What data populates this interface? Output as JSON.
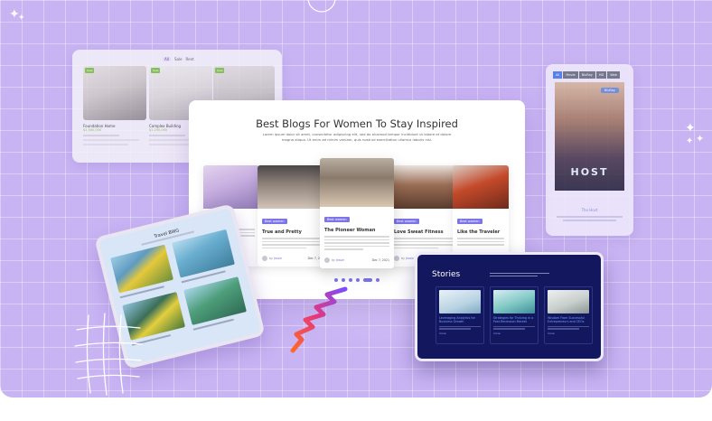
{
  "property_card": {
    "tabs": [
      "All",
      "Sale",
      "Rent"
    ],
    "items": [
      {
        "badge": "Sale",
        "name": "Foundation Home",
        "price": "$1,500,000"
      },
      {
        "badge": "Sale",
        "name": "Complex Building",
        "price": "$1,250,000"
      },
      {
        "badge": "Sale",
        "name": "",
        "price": ""
      }
    ]
  },
  "phone": {
    "tabs": [
      "All",
      "Movie",
      "BluRay",
      "HD",
      "Web"
    ],
    "button": "BluRay",
    "poster_title": "HOST",
    "card_title": "The Host"
  },
  "main": {
    "title": "Best Blogs For Women To Stay Inspired",
    "description": "Lorem ipsum dolor sit amet, consectetur adipiscing elit, sed do eiusmod tempor incididunt ut labore et dolore magna aliqua. Ut enim ad minim veniam, quis nostrud exercitation ullamco laboris nisi.",
    "blogs": [
      {
        "tag": "Best women",
        "name": "",
        "author": "",
        "date": ""
      },
      {
        "tag": "Best women",
        "name": "True and Pretty",
        "author": "Jessie",
        "date": "Dec 7, 2021"
      },
      {
        "tag": "Best women",
        "name": "The Pioneer Woman",
        "author": "Jessie",
        "date": "Dec 7, 2021"
      },
      {
        "tag": "Best women",
        "name": "Love Sweat Fitness",
        "author": "Jessie",
        "date": ""
      },
      {
        "tag": "Best women",
        "name": "Like the Traveler",
        "author": "",
        "date": ""
      }
    ]
  },
  "tablet": {
    "title": "Travel BWG"
  },
  "stories": {
    "title": "Stories",
    "items": [
      {
        "title": "Leveraging Analytics for Business Growth",
        "more": "more"
      },
      {
        "title": "Strategies for Thriving in a Post-Recession Market",
        "more": "more"
      },
      {
        "title": "Wisdom From Successful Entrepreneurs and CEOs",
        "more": "more"
      }
    ]
  },
  "colors": {
    "background": "#c8b3f3",
    "accent": "#7d74e8",
    "stories_bg": "#13175e",
    "badge_green": "#7bc043"
  }
}
